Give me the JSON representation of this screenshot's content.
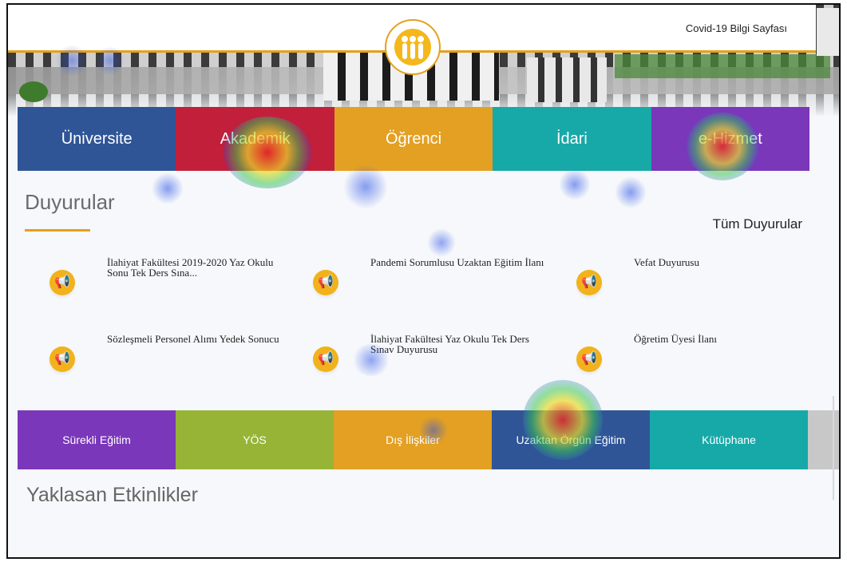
{
  "header": {
    "covid_link": "Covid-19 Bilgi Sayfası"
  },
  "main_nav": [
    {
      "label": "Üniversite",
      "color": "#2f5597"
    },
    {
      "label": "Akademik",
      "color": "#c11f3a"
    },
    {
      "label": "Öğrenci",
      "color": "#e3a022"
    },
    {
      "label": "İdari",
      "color": "#17a9a8"
    },
    {
      "label": "e-Hizmet",
      "color": "#7b37ba"
    }
  ],
  "announcements": {
    "title": "Duyurular",
    "all_link": "Tüm Duyurular",
    "icon": "megaphone-icon",
    "items": [
      {
        "text": "İlahiyat Fakültesi 2019-2020 Yaz Okulu Sonu Tek Ders Sına..."
      },
      {
        "text": "Pandemi Sorumlusu Uzaktan Eğitim İlanı"
      },
      {
        "text": "Vefat Duyurusu"
      },
      {
        "text": "Sözleşmeli Personel Alımı Yedek Sonucu"
      },
      {
        "text": "İlahiyat Fakültesi Yaz Okulu Tek Ders Sınav Duyurusu"
      },
      {
        "text": "Öğretim Üyesi İlanı"
      }
    ]
  },
  "bottom_nav": [
    {
      "label": "Sürekli Eğitim",
      "color": "#7b37ba"
    },
    {
      "label": "YÖS",
      "color": "#97b437"
    },
    {
      "label": "Dış İlişkiler",
      "color": "#e3a022"
    },
    {
      "label": "Uzaktan Örgün Eğitim",
      "color": "#2f5597"
    },
    {
      "label": "Kütüphane",
      "color": "#17a9a8"
    }
  ],
  "events": {
    "title": "Yaklasan Etkinlikler"
  },
  "theme": {
    "accent": "#e4a11b"
  }
}
